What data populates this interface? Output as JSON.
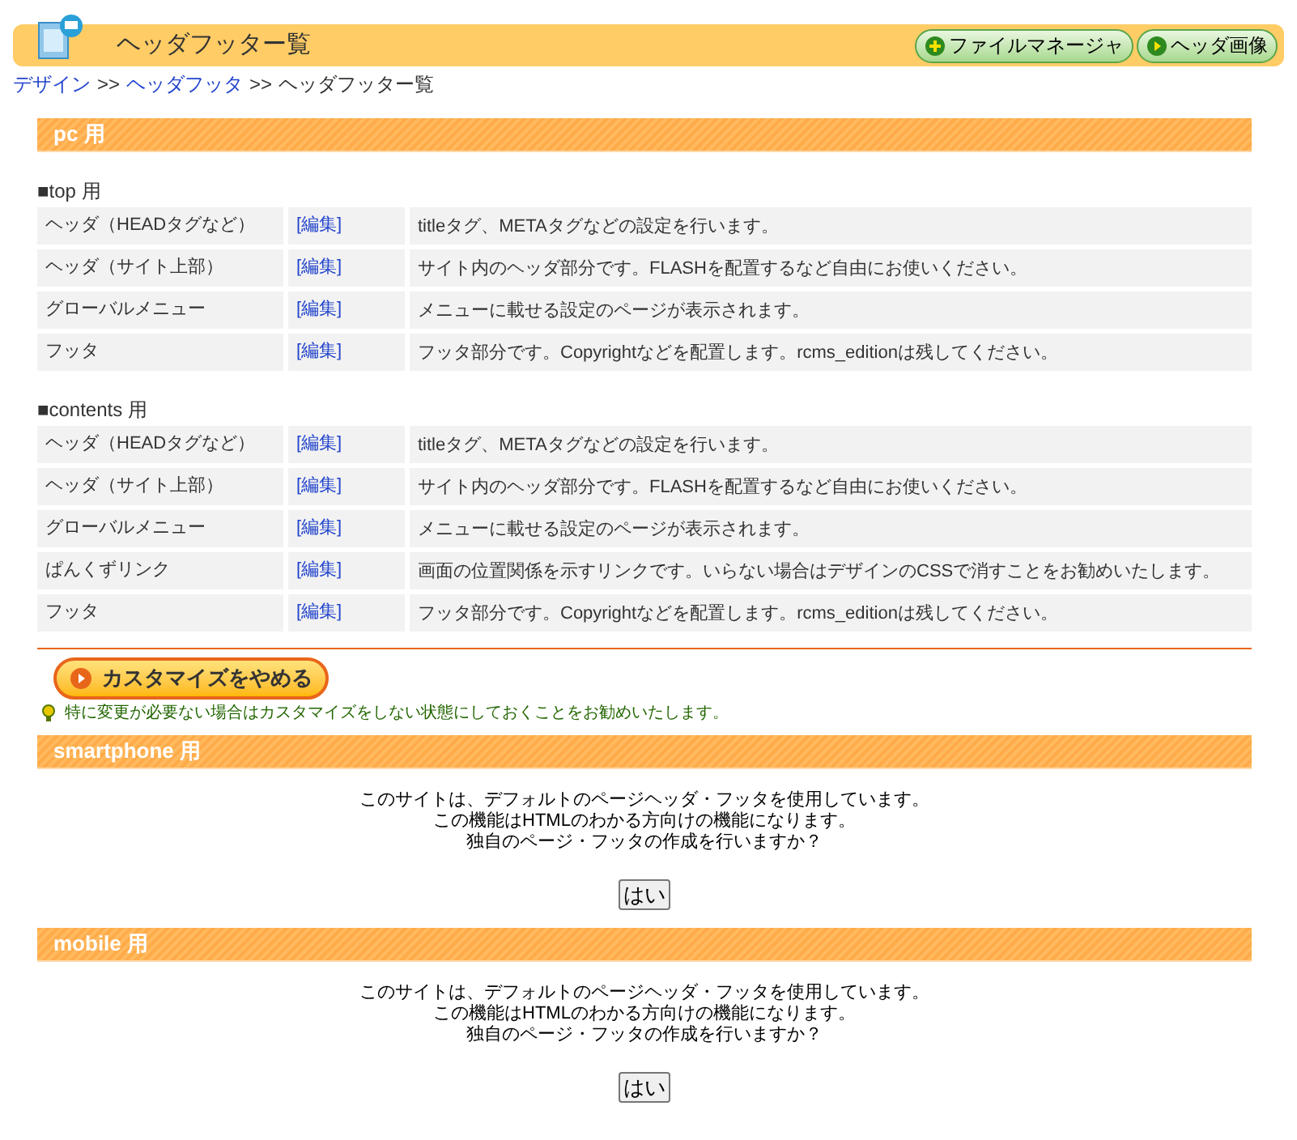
{
  "header": {
    "title": "ヘッダフッター覧",
    "buttons": [
      {
        "label": "ファイルマネージャ",
        "kind": "plus"
      },
      {
        "label": "ヘッダ画像",
        "kind": "play"
      }
    ]
  },
  "breadcrumb": [
    {
      "label": "デザイン",
      "link": true
    },
    {
      "label": ">>",
      "link": false
    },
    {
      "label": "ヘッダフッタ",
      "link": true
    },
    {
      "label": ">>",
      "link": false
    },
    {
      "label": "ヘッダフッター覧",
      "link": false
    }
  ],
  "pc": {
    "title": "pc 用",
    "groups": [
      {
        "title": "■top 用",
        "rows": [
          {
            "name": "ヘッダ（HEADタグなど）",
            "action": "[編集]",
            "description": "titleタグ、METAタグなどの設定を行います。"
          },
          {
            "name": "ヘッダ（サイト上部）",
            "action": "[編集]",
            "description": "サイト内のヘッダ部分です。FLASHを配置するなど自由にお使いください。"
          },
          {
            "name": "グローバルメニュー",
            "action": "[編集]",
            "description": "メニューに載せる設定のページが表示されます。"
          },
          {
            "name": "フッタ",
            "action": "[編集]",
            "description": "フッタ部分です。Copyrightなどを配置します。rcms_editionは残してください。"
          }
        ]
      },
      {
        "title": "■contents 用",
        "rows": [
          {
            "name": "ヘッダ（HEADタグなど）",
            "action": "[編集]",
            "description": "titleタグ、METAタグなどの設定を行います。"
          },
          {
            "name": "ヘッダ（サイト上部）",
            "action": "[編集]",
            "description": "サイト内のヘッダ部分です。FLASHを配置するなど自由にお使いください。"
          },
          {
            "name": "グローバルメニュー",
            "action": "[編集]",
            "description": "メニューに載せる設定のページが表示されます。"
          },
          {
            "name": "ぱんくずリンク",
            "action": "[編集]",
            "description": "画面の位置関係を示すリンクです。いらない場合はデザインのCSSで消すことをお勧めいたします。"
          },
          {
            "name": "フッタ",
            "action": "[編集]",
            "description": "フッタ部分です。Copyrightなどを配置します。rcms_editionは残してください。"
          }
        ]
      }
    ],
    "stop_button": "カスタマイズをやめる",
    "tip": "特に変更が必要ない場合はカスタマイズをしない状態にしておくことをお勧めいたします。"
  },
  "sections": [
    {
      "title": "smartphone 用",
      "lines": [
        "このサイトは、デフォルトのページヘッダ・フッタを使用しています。",
        "この機能はHTMLのわかる方向けの機能になります。",
        "独自のページ・フッタの作成を行いますか？"
      ],
      "button": "はい"
    },
    {
      "title": "mobile 用",
      "lines": [
        "このサイトは、デフォルトのページヘッダ・フッタを使用しています。",
        "この機能はHTMLのわかる方向けの機能になります。",
        "独自のページ・フッタの作成を行いますか？"
      ],
      "button": "はい"
    }
  ]
}
